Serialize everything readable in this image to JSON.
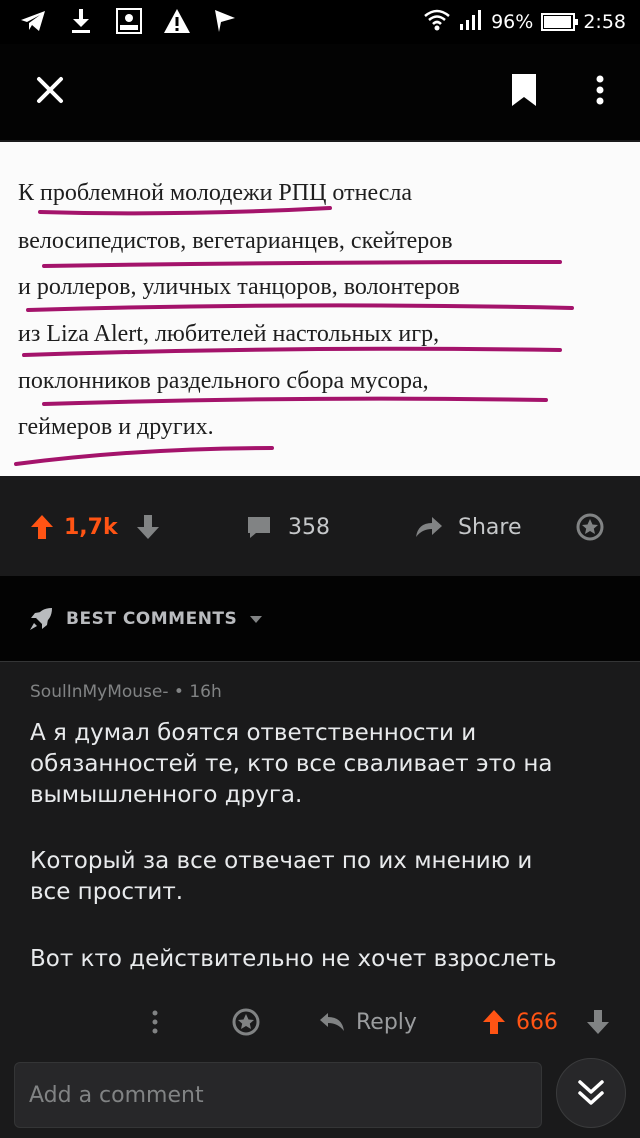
{
  "status_bar": {
    "battery": "96%",
    "battery_level": 0.96,
    "time": "2:58",
    "left_icons": [
      "telegram-icon",
      "download-icon",
      "rec-icon",
      "warning-icon",
      "send-icon"
    ]
  },
  "header": {
    "close_icon": "close-icon",
    "bookmark_icon": "bookmark-icon",
    "more_icon": "more-vertical-icon"
  },
  "post_image": {
    "lines": [
      "К проблемной молодежи РПЦ отнесла",
      "велосипедистов, вегетарианцев, скейтеров",
      "и роллеров, уличных танцоров, волонтеров",
      "из Liza Alert, любителей настольных игр,",
      "поклонников раздельного сбора мусора,",
      "геймеров и других."
    ],
    "underline_color": "#a4136b"
  },
  "post_actions": {
    "upvotes": "1,7k",
    "comments": "358",
    "share_label": "Share"
  },
  "sort": {
    "label": "BEST COMMENTS"
  },
  "comment": {
    "author": "SoulInMyMouse-",
    "time": "16h",
    "paragraphs": [
      "А я думал боятся ответственности и обязанностей те, кто все сваливает это на вымышленного друга.",
      "Который за все отвечает по их мнению и все простит.",
      "Вот кто действительно не хочет взрослеть"
    ],
    "reply_label": "Reply",
    "score": "666"
  },
  "composer": {
    "placeholder": "Add a comment"
  },
  "colors": {
    "upvote": "#ff5414",
    "background": "#1a1a1b",
    "header": "#030303"
  }
}
